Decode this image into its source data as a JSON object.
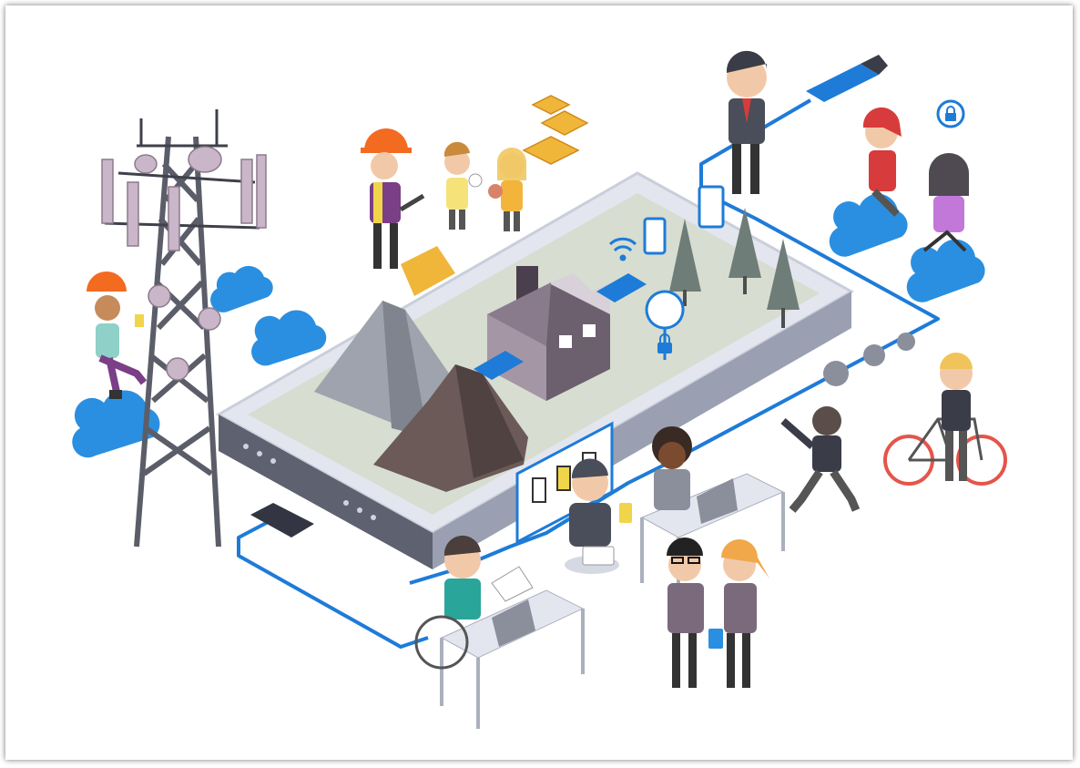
{
  "illustration": {
    "kind": "isometric connected-industry scene",
    "colors": {
      "accent_blue": "#1e7bd8",
      "cloud_blue": "#2a8fe0",
      "phone_body": "#e3e6ef",
      "phone_screen": "#d7ddd0",
      "tower_grey": "#5b5e69",
      "factory_purple": "#8a7b8c",
      "mountain_grey": "#9ea3ad",
      "rock_brown": "#6b5a58",
      "tree_grey": "#6f7d78",
      "chip_gold": "#f0b63a",
      "helmet_orange": "#f26b21",
      "bicycle_red": "#e4554a"
    },
    "icons": [
      "cell-tower-icon",
      "cloud-icon",
      "factory-icon",
      "lock-icon",
      "wifi-icon",
      "usb-stick-icon",
      "gear-icon",
      "bicycle-icon",
      "laptop-icon",
      "microchip-icon"
    ]
  }
}
